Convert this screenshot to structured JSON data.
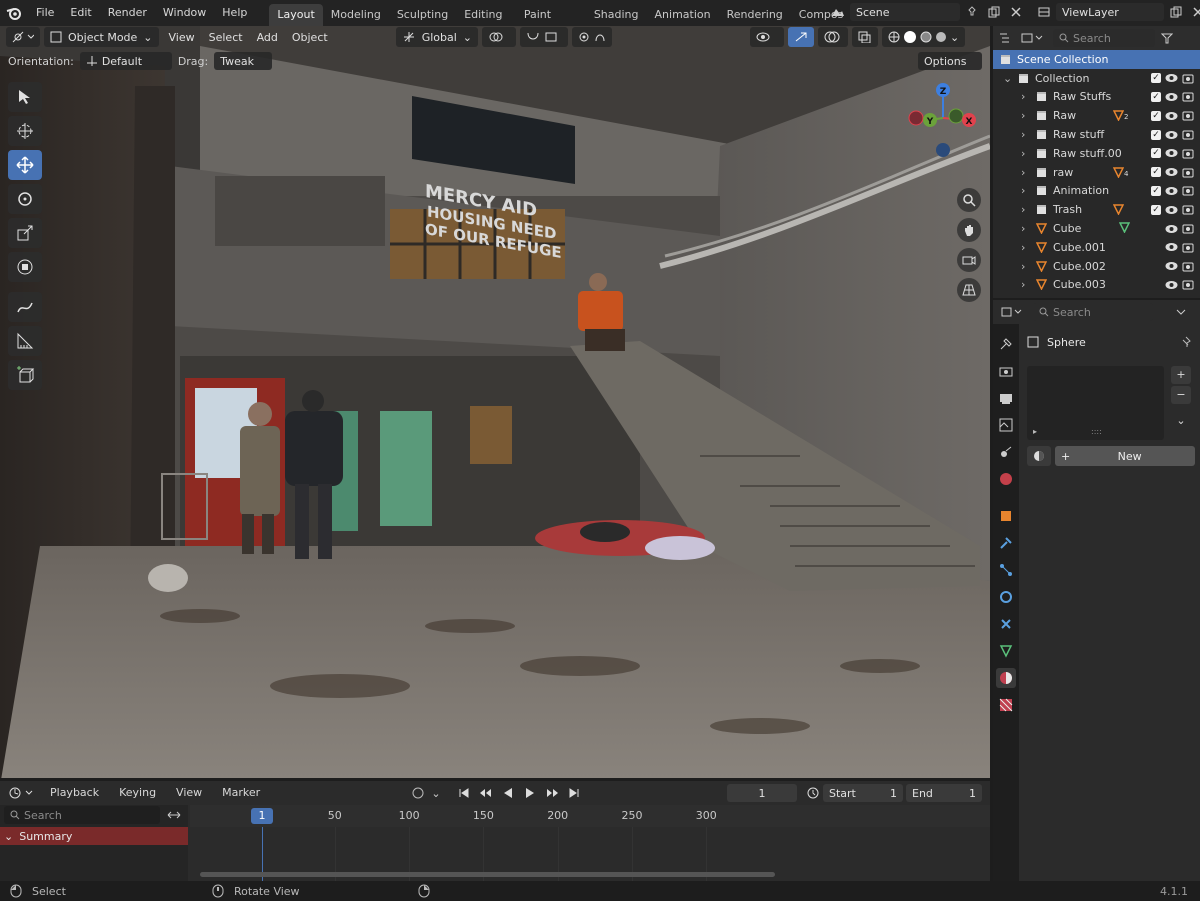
{
  "topbar": {
    "menus": [
      "File",
      "Edit",
      "Render",
      "Window",
      "Help"
    ],
    "workspaces": [
      "Layout",
      "Modeling",
      "Sculpting",
      "UV Editing",
      "Texture Paint",
      "Shading",
      "Animation",
      "Rendering",
      "Compos"
    ],
    "active_workspace": "Layout",
    "scene_name": "Scene",
    "view_layer": "ViewLayer"
  },
  "viewport": {
    "mode": "Object Mode",
    "menus": [
      "View",
      "Select",
      "Add",
      "Object"
    ],
    "transform_orientation": "Global",
    "orientation_label": "Orientation:",
    "orientation_value": "Default",
    "drag_label": "Drag:",
    "drag_value": "Tweak",
    "options_label": "Options",
    "sign_lines": [
      "MERCY AID",
      "HOUSING  NEED",
      "OF OUR REFUGE"
    ],
    "gizmo_axes": [
      "Z",
      "Y",
      "X"
    ]
  },
  "outliner": {
    "search_placeholder": "Search",
    "rows": [
      {
        "name": "Scene Collection",
        "indent": 0,
        "selected": true,
        "kind": "scene"
      },
      {
        "name": "Collection",
        "indent": 1,
        "kind": "collection",
        "expanded": true
      },
      {
        "name": "Raw Stuffs",
        "indent": 2,
        "kind": "collection"
      },
      {
        "name": "Raw",
        "indent": 2,
        "kind": "collection",
        "badge": "2"
      },
      {
        "name": "Raw stuff",
        "indent": 2,
        "kind": "collection"
      },
      {
        "name": "Raw stuff.00",
        "indent": 2,
        "kind": "collection"
      },
      {
        "name": "raw",
        "indent": 2,
        "kind": "collection",
        "badge": "4"
      },
      {
        "name": "Animation",
        "indent": 2,
        "kind": "collection"
      },
      {
        "name": "Trash",
        "indent": 2,
        "kind": "collection",
        "badge": ""
      },
      {
        "name": "Cube",
        "indent": 2,
        "kind": "mesh",
        "has_data": true
      },
      {
        "name": "Cube.001",
        "indent": 2,
        "kind": "mesh"
      },
      {
        "name": "Cube.002",
        "indent": 2,
        "kind": "mesh"
      },
      {
        "name": "Cube.003",
        "indent": 2,
        "kind": "mesh"
      }
    ]
  },
  "properties": {
    "search_placeholder": "Search",
    "object_name": "Sphere",
    "new_label": "New",
    "add_symbol": "+",
    "remove_symbol": "−",
    "drag_symbol": "::::"
  },
  "timeline": {
    "menus": [
      "Playback",
      "Keying",
      "View",
      "Marker"
    ],
    "current_frame": "1",
    "start_label": "Start",
    "start_value": "1",
    "end_label": "End",
    "end_value": "1",
    "search_placeholder": "Search",
    "summary_label": "Summary",
    "ruler": [
      "1",
      "50",
      "100",
      "150",
      "200",
      "250",
      "300"
    ]
  },
  "statusbar": {
    "left_action": "Select",
    "middle_action": "Rotate View",
    "version": "4.1.1"
  },
  "colors": {
    "accent": "#4772b3",
    "summary": "#7a2a2a",
    "axis_x": "#e0424d",
    "axis_y": "#6ba23a",
    "axis_z": "#3d7fe0"
  }
}
